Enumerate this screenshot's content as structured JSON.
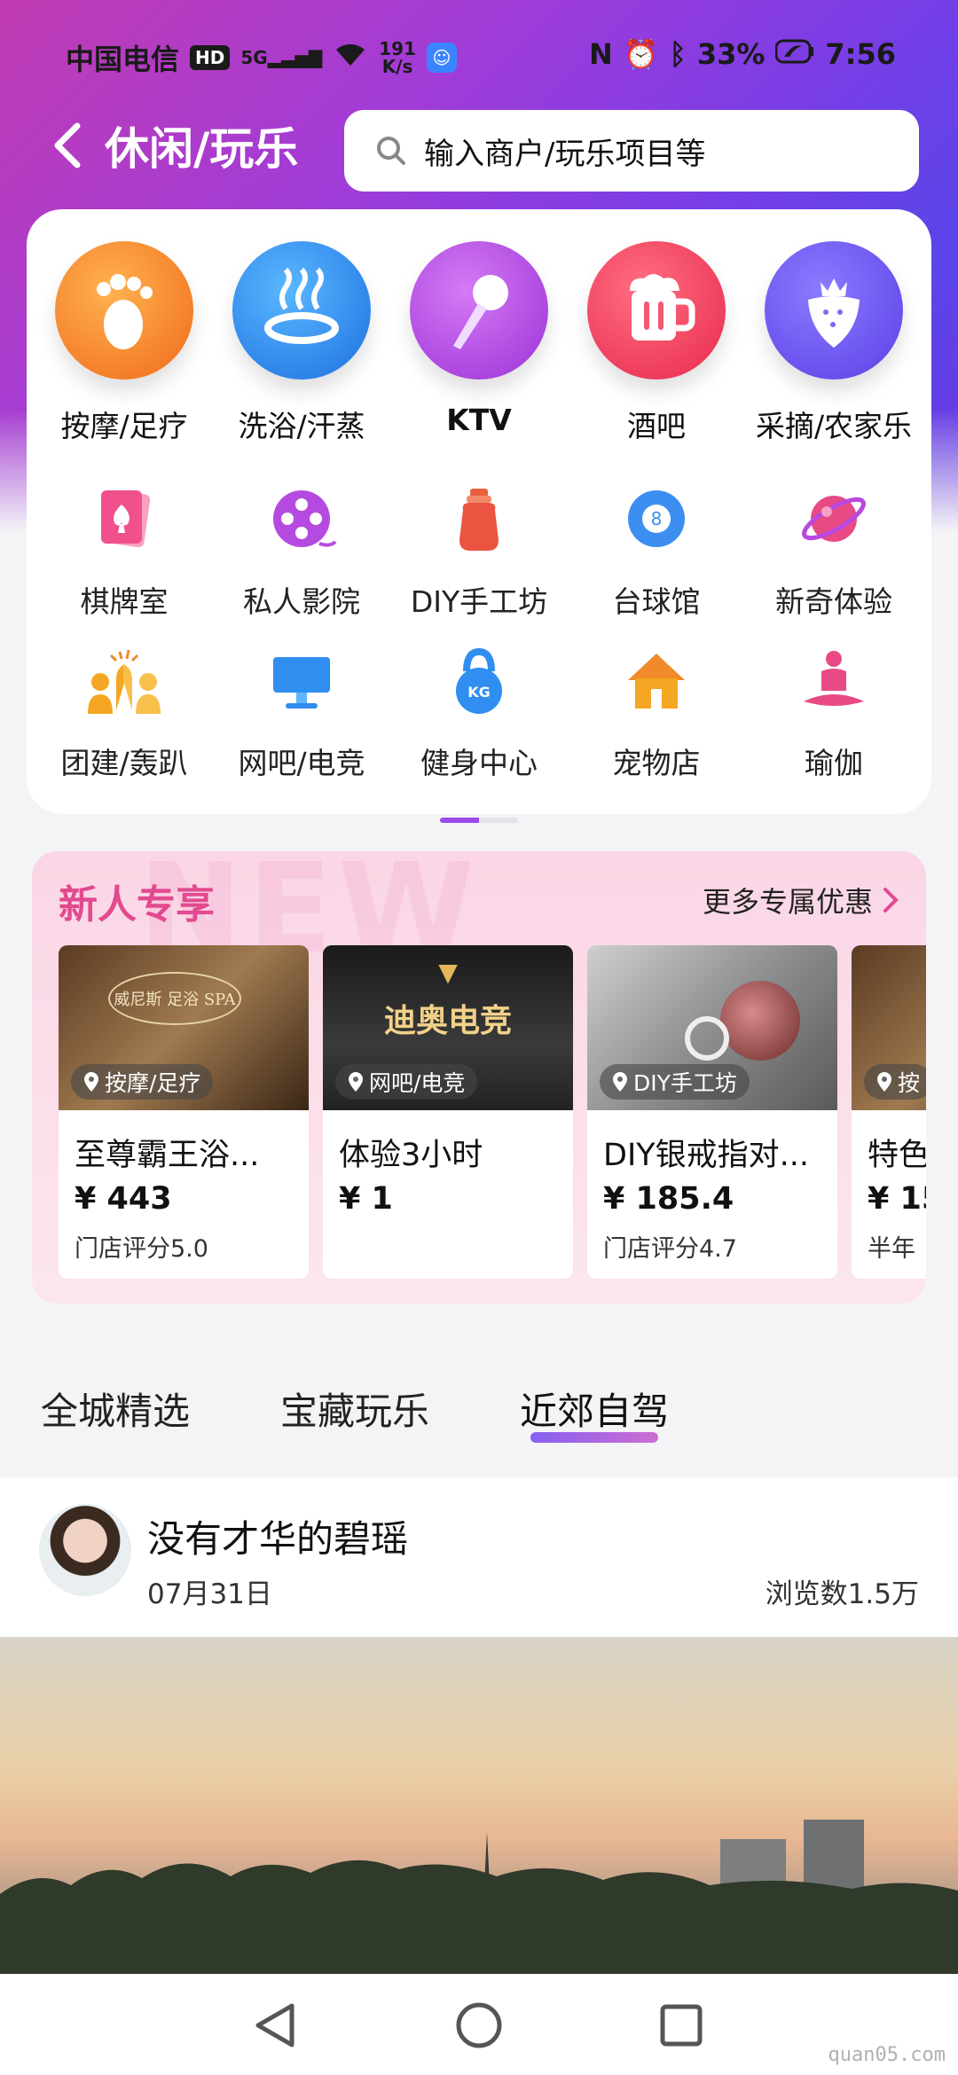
{
  "status_bar": {
    "carrier": "中国电信",
    "hd": "HD",
    "network": "5G",
    "speed_value": "191",
    "speed_unit": "K/s",
    "battery": "33%",
    "time": "7:56"
  },
  "topbar": {
    "title": "休闲/玩乐",
    "search_placeholder": "输入商户/玩乐项目等"
  },
  "categories_primary": [
    {
      "label": "按摩/足疗",
      "icon": "footprint-icon",
      "color": "#f28a2a"
    },
    {
      "label": "洗浴/汗蒸",
      "icon": "hot-spring-icon",
      "color": "#3c8ff0"
    },
    {
      "label": "KTV",
      "icon": "microphone-icon",
      "color": "#b24de0"
    },
    {
      "label": "酒吧",
      "icon": "beer-mug-icon",
      "color": "#f0456a"
    },
    {
      "label": "采摘/农家乐",
      "icon": "strawberry-icon",
      "color": "#6f5bf0"
    }
  ],
  "categories_secondary": [
    {
      "label": "棋牌室",
      "icon": "playing-card-icon"
    },
    {
      "label": "私人影院",
      "icon": "film-reel-icon"
    },
    {
      "label": "DIY手工坊",
      "icon": "craft-jar-icon"
    },
    {
      "label": "台球馆",
      "icon": "billiard-ball-icon"
    },
    {
      "label": "新奇体验",
      "icon": "planet-icon"
    },
    {
      "label": "团建/轰趴",
      "icon": "high-five-icon"
    },
    {
      "label": "网吧/电竞",
      "icon": "monitor-icon"
    },
    {
      "label": "健身中心",
      "icon": "kettlebell-icon"
    },
    {
      "label": "宠物店",
      "icon": "pet-house-icon"
    },
    {
      "label": "瑜伽",
      "icon": "yoga-icon"
    }
  ],
  "newbie": {
    "title": "新人专享",
    "watermark": "NEW",
    "more_label": "更多专属优惠",
    "cards": [
      {
        "tag": "按摩/足疗",
        "name": "至尊霸王浴...",
        "price": "¥ 443",
        "rating": "门店评分5.0",
        "logo": "威尼斯 足浴 SPA"
      },
      {
        "tag": "网吧/电竞",
        "name": "体验3小时",
        "price": "¥ 1",
        "rating": "",
        "logo": "迪奥电竞"
      },
      {
        "tag": "DIY手工坊",
        "name": "DIY银戒指对...",
        "price": "¥ 185.4",
        "rating": "门店评分4.7",
        "logo": ""
      },
      {
        "tag": "按",
        "name": "特色",
        "price": "¥ 15",
        "rating": "半年",
        "logo": ""
      }
    ]
  },
  "feed_tabs": [
    {
      "label": "全城精选"
    },
    {
      "label": "宝藏玩乐"
    },
    {
      "label": "近郊自驾"
    }
  ],
  "post": {
    "author": "没有才华的碧瑶",
    "date": "07月31日",
    "views": "浏览数1.5万"
  },
  "watermark_site": "quan05.com"
}
